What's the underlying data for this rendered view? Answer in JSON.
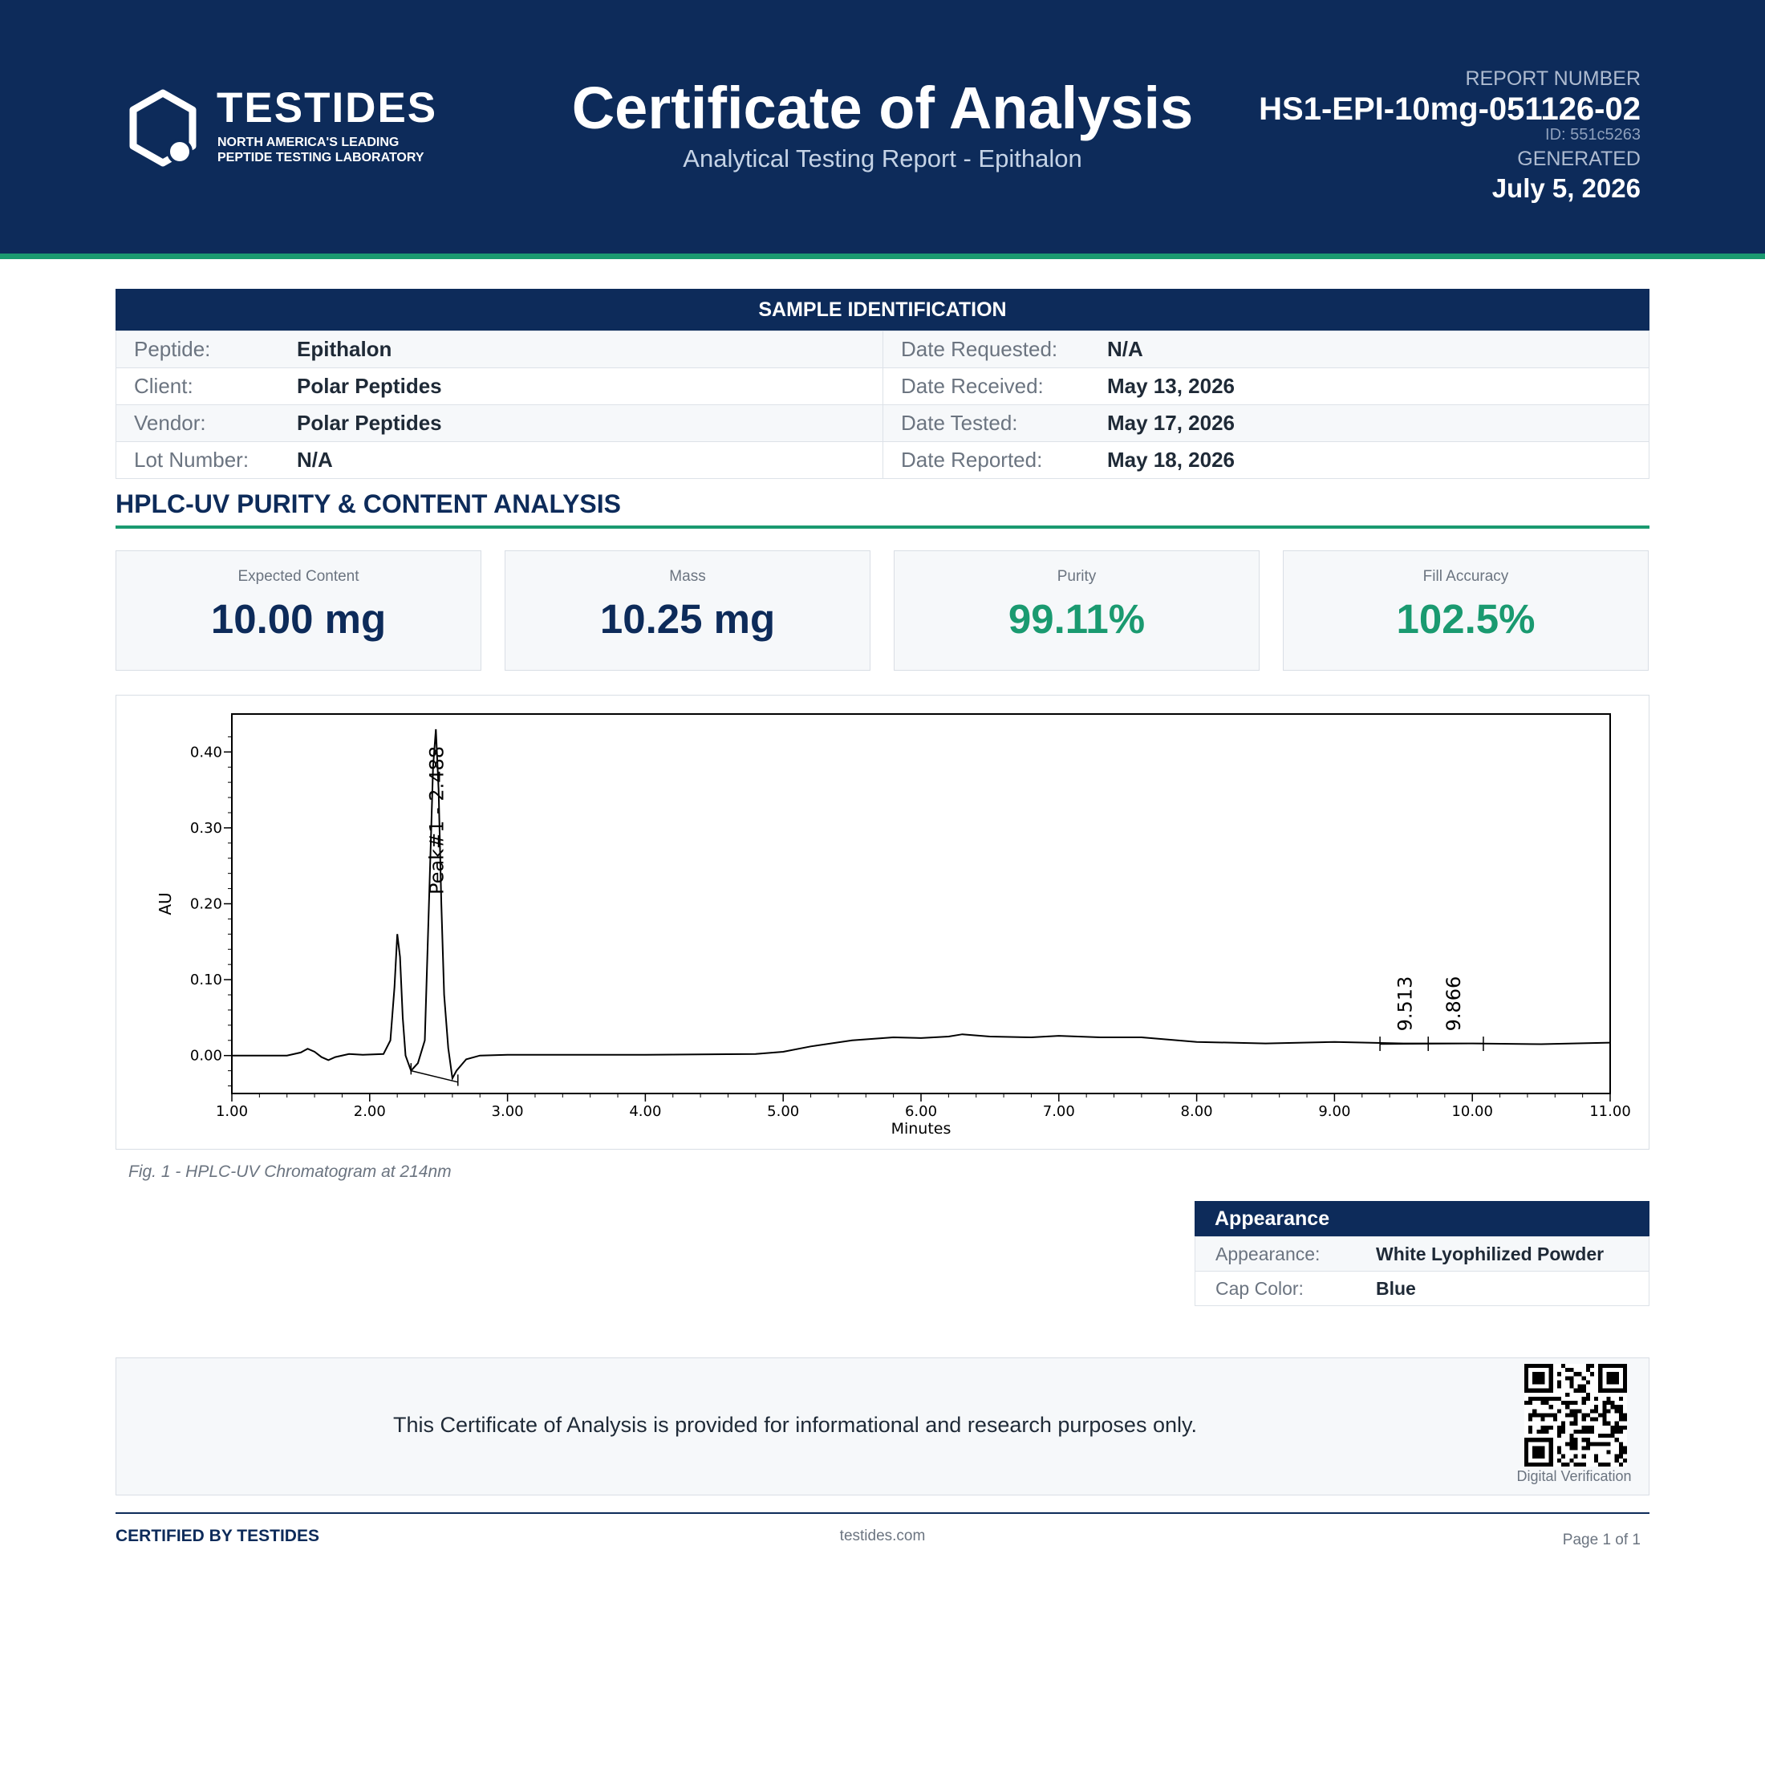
{
  "header": {
    "brand": "TESTIDES",
    "tagline_line1": "NORTH AMERICA'S LEADING",
    "tagline_line2": "PEPTIDE TESTING LABORATORY",
    "title": "Certificate of Analysis",
    "subtitle": "Analytical Testing Report  -  Epithalon",
    "report_number_label": "REPORT NUMBER",
    "report_number": "HS1-EPI-10mg-051126-02",
    "report_id": "ID: 551c5263",
    "generated_label": "GENERATED",
    "generated_date": "July 5, 2026"
  },
  "sample": {
    "heading": "SAMPLE IDENTIFICATION",
    "rows": [
      {
        "l1": "Peptide:",
        "v1": "Epithalon",
        "l2": "Date Requested:",
        "v2": "N/A"
      },
      {
        "l1": "Client:",
        "v1": "Polar Peptides",
        "l2": "Date Received:",
        "v2": "May 13, 2026"
      },
      {
        "l1": "Vendor:",
        "v1": "Polar Peptides",
        "l2": "Date Tested:",
        "v2": "May 17, 2026"
      },
      {
        "l1": "Lot Number:",
        "v1": "N/A",
        "l2": "Date Reported:",
        "v2": "May 18, 2026"
      }
    ]
  },
  "analysis": {
    "heading": "HPLC-UV PURITY & CONTENT ANALYSIS",
    "cards": [
      {
        "label": "Expected Content",
        "value": "10.00 mg"
      },
      {
        "label": "Mass",
        "value": "10.25 mg"
      },
      {
        "label": "Purity",
        "value": "99.11%"
      },
      {
        "label": "Fill Accuracy",
        "value": "102.5%"
      }
    ],
    "figure_caption": "Fig. 1  -  HPLC-UV Chromatogram at 214nm"
  },
  "chart_data": {
    "type": "line",
    "xlabel": "Minutes",
    "ylabel": "AU",
    "xlim": [
      1.0,
      11.0
    ],
    "ylim": [
      -0.05,
      0.45
    ],
    "x_ticks": [
      "1.00",
      "2.00",
      "3.00",
      "4.00",
      "5.00",
      "6.00",
      "7.00",
      "8.00",
      "9.00",
      "10.00",
      "11.00"
    ],
    "y_ticks": [
      "0.00",
      "0.10",
      "0.20",
      "0.30",
      "0.40"
    ],
    "series": [
      {
        "x": [
          1.0,
          1.4,
          1.5,
          1.55,
          1.6,
          1.65,
          1.7,
          1.75,
          1.85,
          1.95,
          2.1,
          2.15,
          2.18,
          2.2,
          2.22,
          2.24,
          2.26,
          2.28,
          2.3,
          2.35,
          2.4,
          2.44,
          2.46,
          2.48,
          2.5,
          2.52,
          2.54,
          2.57,
          2.6,
          2.63,
          2.7,
          2.8,
          3.0,
          4.0,
          4.8,
          5.0,
          5.2,
          5.5,
          5.8,
          6.0,
          6.2,
          6.3,
          6.5,
          6.8,
          7.0,
          7.3,
          7.6,
          8.0,
          8.5,
          9.0,
          9.5,
          10.0,
          10.5,
          11.0
        ],
        "y": [
          0.0,
          0.0,
          0.004,
          0.009,
          0.005,
          -0.002,
          -0.006,
          -0.002,
          0.002,
          0.001,
          0.002,
          0.02,
          0.09,
          0.16,
          0.13,
          0.05,
          0.0,
          -0.01,
          -0.02,
          -0.01,
          0.02,
          0.26,
          0.38,
          0.43,
          0.35,
          0.2,
          0.08,
          0.01,
          -0.03,
          -0.02,
          -0.005,
          0.0,
          0.001,
          0.001,
          0.002,
          0.005,
          0.012,
          0.02,
          0.024,
          0.023,
          0.025,
          0.028,
          0.025,
          0.024,
          0.026,
          0.024,
          0.024,
          0.018,
          0.016,
          0.018,
          0.016,
          0.016,
          0.015,
          0.017
        ]
      }
    ],
    "peak_labels": [
      {
        "x": 2.488,
        "y": 0.43,
        "text": "Peak#1 - 2.488"
      },
      {
        "x": 9.513,
        "y": 0.016,
        "text": "9.513"
      },
      {
        "x": 9.866,
        "y": 0.016,
        "text": "9.866"
      }
    ],
    "grid": false
  },
  "appearance": {
    "heading": "Appearance",
    "rows": [
      {
        "label": "Appearance:",
        "value": "White Lyophilized Powder"
      },
      {
        "label": "Cap Color:",
        "value": "Blue"
      }
    ]
  },
  "disclaimer": {
    "text": "This Certificate of Analysis is provided for informational and research purposes only.",
    "qr_caption": "Digital Verification"
  },
  "footer": {
    "certified": "CERTIFIED BY TESTIDES",
    "website": "testides.com",
    "page": "Page 1 of 1"
  },
  "colors": {
    "navy": "#0d2b5a",
    "green": "#1a9a70"
  }
}
